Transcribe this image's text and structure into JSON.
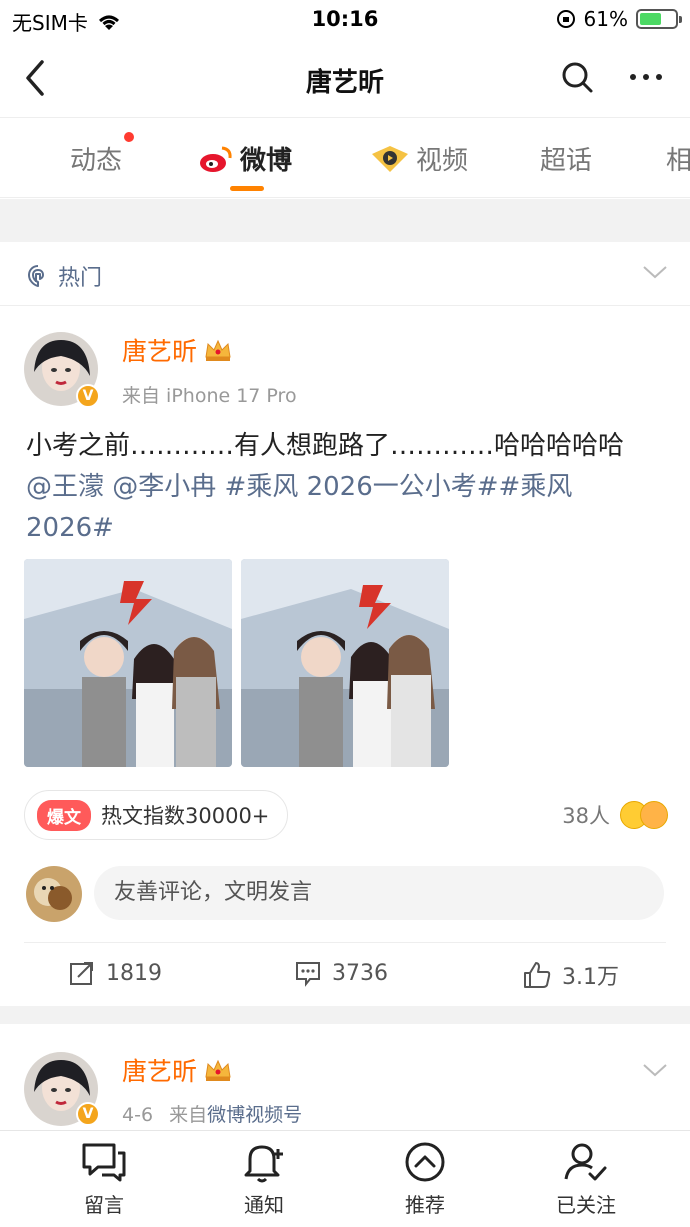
{
  "status_bar": {
    "carrier": "无SIM卡",
    "time": "10:16",
    "battery": "61%"
  },
  "nav": {
    "title": "唐艺昕"
  },
  "tabs": [
    {
      "label": "动态"
    },
    {
      "label": "微博"
    },
    {
      "label": "视频"
    },
    {
      "label": "超话"
    },
    {
      "label": "相"
    }
  ],
  "hot_section": {
    "label": "热门"
  },
  "post": {
    "author": "唐艺昕",
    "verified_badge": "V",
    "source": "来自 iPhone 17 Pro",
    "text": "小考之前…………有人想跑路了…………哈哈哈哈哈",
    "mentions_tags": "@王濛 @李小冉 #乘风 2026一公小考##乘风 2026#",
    "hot_badge": "爆文",
    "hot_index": "热文指数30000+",
    "reactors": "38人",
    "comment_placeholder": "友善评论，文明发言",
    "reposts": "1819",
    "comments": "3736",
    "likes": "3.1万"
  },
  "post2": {
    "author": "唐艺昕",
    "date": "4-6",
    "source_prefix": "来自",
    "source_link": "微博视频号"
  },
  "bottom_bar": [
    {
      "label": "留言",
      "icon": "message-icon"
    },
    {
      "label": "通知",
      "icon": "bell-icon"
    },
    {
      "label": "推荐",
      "icon": "recommend-icon"
    },
    {
      "label": "已关注",
      "icon": "followed-icon"
    }
  ],
  "colors": {
    "accent": "#ff8200",
    "name": "#ff6a00",
    "link": "#5a6d8c"
  }
}
